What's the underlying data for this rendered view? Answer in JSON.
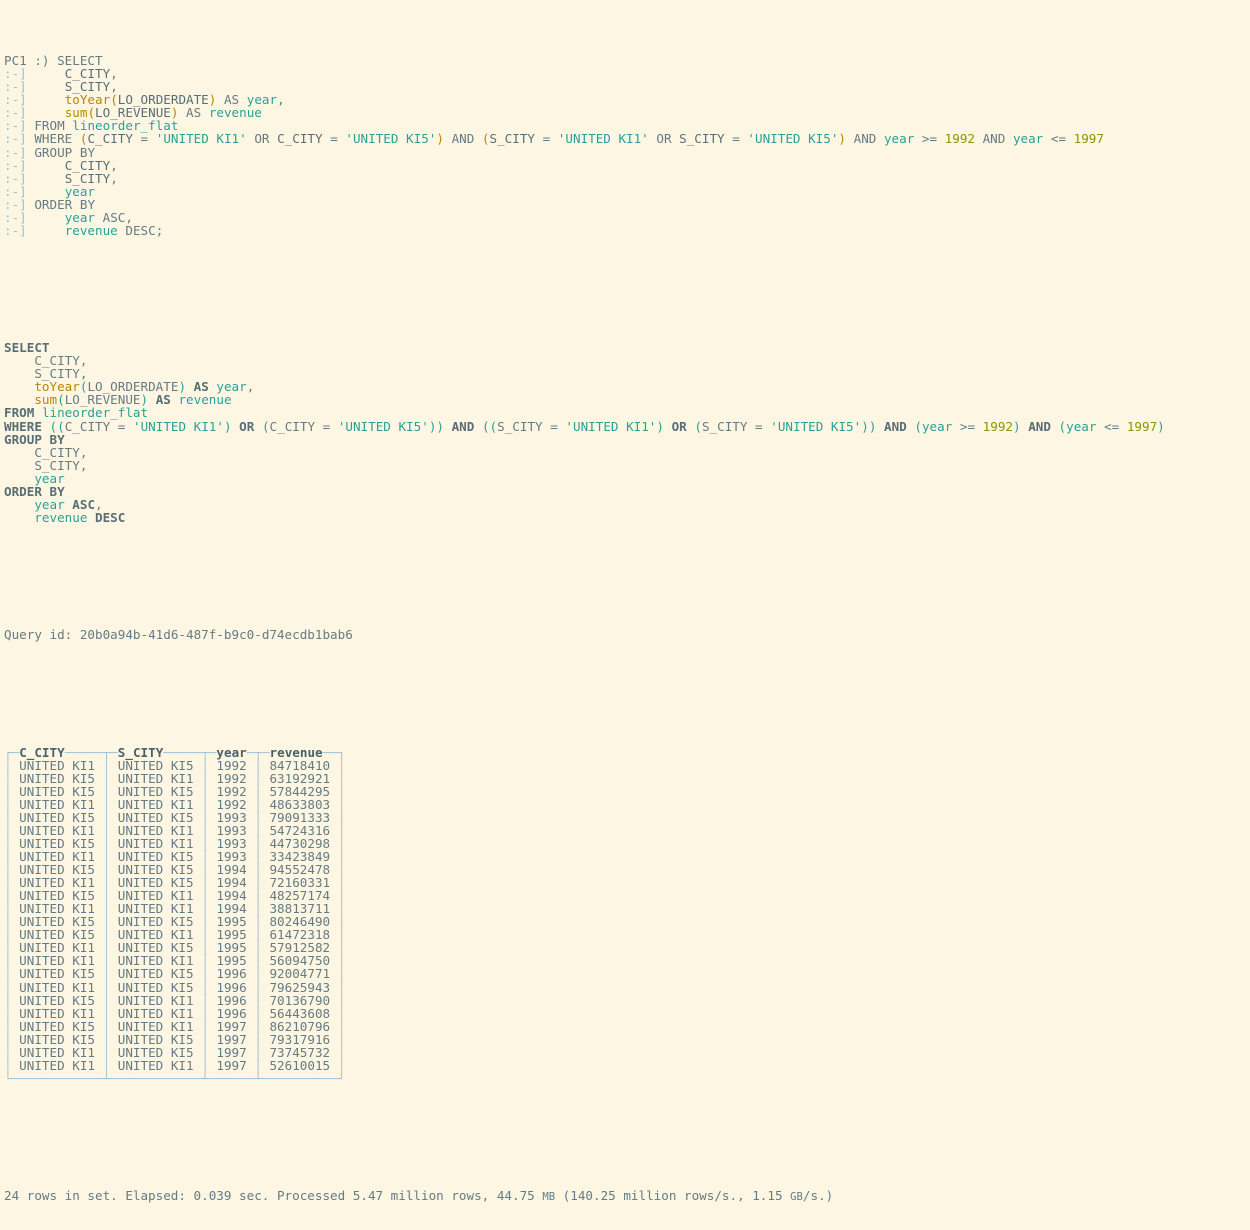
{
  "terminal": {
    "background_color": "#fdf6e3",
    "foreground_color": "#657b83",
    "prompt": "PC1 :)",
    "continuation_prompt": ":-]"
  },
  "input_query": {
    "lines": [
      {
        "prompt": "PC1 :)",
        "text": "SELECT"
      },
      {
        "prompt": ":-]",
        "text": "    C_CITY,"
      },
      {
        "prompt": ":-]",
        "text": "    S_CITY,"
      },
      {
        "prompt": ":-]",
        "text": "    toYear(LO_ORDERDATE) AS year,"
      },
      {
        "prompt": ":-]",
        "text": "    sum(LO_REVENUE) AS revenue"
      },
      {
        "prompt": ":-]",
        "text": "FROM lineorder_flat"
      },
      {
        "prompt": ":-]",
        "text": "WHERE (C_CITY = 'UNITED KI1' OR C_CITY = 'UNITED KI5') AND (S_CITY = 'UNITED KI1' OR S_CITY = 'UNITED KI5') AND year >= 1992 AND year <= 1997"
      },
      {
        "prompt": ":-]",
        "text": "GROUP BY"
      },
      {
        "prompt": ":-]",
        "text": "    C_CITY,"
      },
      {
        "prompt": ":-]",
        "text": "    S_CITY,"
      },
      {
        "prompt": ":-]",
        "text": "    year"
      },
      {
        "prompt": ":-]",
        "text": "ORDER BY"
      },
      {
        "prompt": ":-]",
        "text": "    year ASC,"
      },
      {
        "prompt": ":-]",
        "text": "    revenue DESC;"
      }
    ]
  },
  "formatted_query": {
    "lines": [
      "SELECT",
      "    C_CITY,",
      "    S_CITY,",
      "    toYear(LO_ORDERDATE) AS year,",
      "    sum(LO_REVENUE) AS revenue",
      "FROM lineorder_flat",
      "WHERE ((C_CITY = 'UNITED KI1') OR (C_CITY = 'UNITED KI5')) AND ((S_CITY = 'UNITED KI1') OR (S_CITY = 'UNITED KI5')) AND (year >= 1992) AND (year <= 1997)",
      "GROUP BY",
      "    C_CITY,",
      "    S_CITY,",
      "    year",
      "ORDER BY",
      "    year ASC,",
      "    revenue DESC"
    ]
  },
  "query_id_label": "Query id:",
  "query_id": "20b0a94b-41d6-487f-b9c0-d74ecdb1bab6",
  "result_table": {
    "columns": [
      "C_CITY",
      "S_CITY",
      "year",
      "revenue"
    ],
    "rows": [
      [
        "UNITED KI1",
        "UNITED KI5",
        "1992",
        "84718410"
      ],
      [
        "UNITED KI5",
        "UNITED KI1",
        "1992",
        "63192921"
      ],
      [
        "UNITED KI5",
        "UNITED KI5",
        "1992",
        "57844295"
      ],
      [
        "UNITED KI1",
        "UNITED KI1",
        "1992",
        "48633803"
      ],
      [
        "UNITED KI5",
        "UNITED KI5",
        "1993",
        "79091333"
      ],
      [
        "UNITED KI1",
        "UNITED KI1",
        "1993",
        "54724316"
      ],
      [
        "UNITED KI5",
        "UNITED KI1",
        "1993",
        "44730298"
      ],
      [
        "UNITED KI1",
        "UNITED KI5",
        "1993",
        "33423849"
      ],
      [
        "UNITED KI5",
        "UNITED KI5",
        "1994",
        "94552478"
      ],
      [
        "UNITED KI1",
        "UNITED KI5",
        "1994",
        "72160331"
      ],
      [
        "UNITED KI5",
        "UNITED KI1",
        "1994",
        "48257174"
      ],
      [
        "UNITED KI1",
        "UNITED KI1",
        "1994",
        "38813711"
      ],
      [
        "UNITED KI5",
        "UNITED KI5",
        "1995",
        "80246490"
      ],
      [
        "UNITED KI5",
        "UNITED KI1",
        "1995",
        "61472318"
      ],
      [
        "UNITED KI1",
        "UNITED KI5",
        "1995",
        "57912582"
      ],
      [
        "UNITED KI1",
        "UNITED KI1",
        "1995",
        "56094750"
      ],
      [
        "UNITED KI5",
        "UNITED KI5",
        "1996",
        "92004771"
      ],
      [
        "UNITED KI1",
        "UNITED KI5",
        "1996",
        "79625943"
      ],
      [
        "UNITED KI5",
        "UNITED KI1",
        "1996",
        "70136790"
      ],
      [
        "UNITED KI1",
        "UNITED KI1",
        "1996",
        "56443608"
      ],
      [
        "UNITED KI5",
        "UNITED KI1",
        "1997",
        "86210796"
      ],
      [
        "UNITED KI5",
        "UNITED KI5",
        "1997",
        "79317916"
      ],
      [
        "UNITED KI1",
        "UNITED KI5",
        "1997",
        "73745732"
      ],
      [
        "UNITED KI1",
        "UNITED KI1",
        "1997",
        "52610015"
      ]
    ]
  },
  "status": {
    "rows_in_set": "24 rows in set.",
    "elapsed": "Elapsed: 0.039 sec.",
    "processed": "Processed 5.47 million rows, 44.75 MB (140.25 million rows/s., 1.15 GB/s.)",
    "full_text": "24 rows in set. Elapsed: 0.039 sec. Processed 5.47 million rows, 44.75 MB (140.25 million rows/s., 1.15 GB/s.)"
  }
}
